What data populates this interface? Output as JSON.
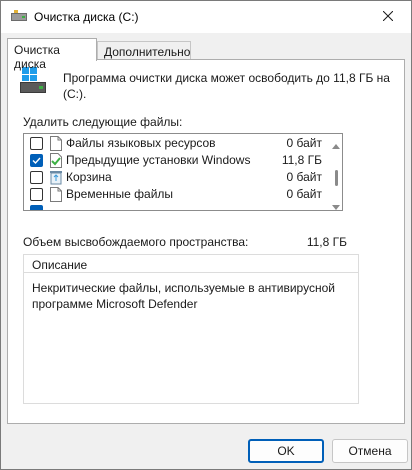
{
  "window": {
    "title": "Очистка диска  (C:)",
    "icon": "disk-cleanup-icon"
  },
  "tabs": [
    {
      "label": "Очистка диска",
      "active": true
    },
    {
      "label": "Дополнительно",
      "active": false
    }
  ],
  "info": {
    "text": "Программа очистки диска может освободить до 11,8 ГБ на  (C:)."
  },
  "files_section": {
    "label": "Удалить следующие файлы:",
    "items": [
      {
        "name": "Файлы языковых ресурсов",
        "size": "0 байт",
        "checked": false,
        "icon": "file-icon"
      },
      {
        "name": "Предыдущие установки Windows",
        "size": "11,8 ГБ",
        "checked": true,
        "icon": "windows-update-icon"
      },
      {
        "name": "Корзина",
        "size": "0 байт",
        "checked": false,
        "icon": "recycle-bin-icon"
      },
      {
        "name": "Временные файлы",
        "size": "0 байт",
        "checked": false,
        "icon": "file-icon"
      }
    ]
  },
  "space": {
    "label": "Объем высвобождаемого пространства:",
    "value": "11,8 ГБ"
  },
  "description": {
    "title": "Описание",
    "text": "Некритические файлы, используемые в антивирусной программе Microsoft Defender"
  },
  "buttons": {
    "ok": "OK",
    "cancel": "Отмена"
  },
  "colors": {
    "accent": "#005fb8",
    "window_bg": "#f0f0f0",
    "panel_bg": "#ffffff"
  }
}
